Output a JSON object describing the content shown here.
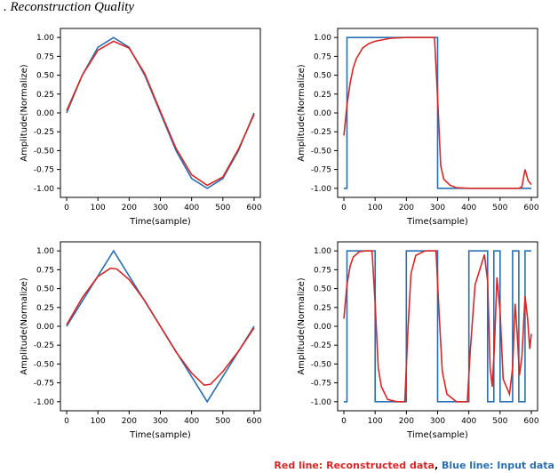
{
  "heading": ". Reconstruction Quality",
  "legend": {
    "red": "Red line: Reconstructed data",
    "blue": "Blue line: Input data"
  },
  "axes": {
    "xlabel": "Time(sample)",
    "ylabel": "Amplitude(Normalize)",
    "xticks": [
      0,
      100,
      200,
      300,
      400,
      500,
      600
    ],
    "yticks": [
      -1.0,
      -0.75,
      -0.5,
      -0.25,
      0.0,
      0.25,
      0.5,
      0.75,
      1.0
    ],
    "xlim": [
      -20,
      620
    ],
    "ylim": [
      -1.12,
      1.12
    ]
  },
  "chart_data": [
    {
      "id": "tl",
      "type": "line",
      "title": "",
      "xlabel": "Time(sample)",
      "ylabel": "Amplitude(Normalize)",
      "xlim": [
        -20,
        620
      ],
      "ylim": [
        -1.12,
        1.12
      ],
      "series": [
        {
          "name": "Input",
          "color": "#2a6fb1",
          "x": [
            0,
            50,
            100,
            150,
            200,
            250,
            300,
            350,
            400,
            450,
            500,
            550,
            600
          ],
          "y": [
            0.0,
            0.5,
            0.87,
            1.0,
            0.87,
            0.5,
            0.0,
            -0.5,
            -0.87,
            -1.0,
            -0.87,
            -0.5,
            0.0
          ]
        },
        {
          "name": "Reconstructed",
          "color": "#d62728",
          "x": [
            0,
            50,
            100,
            150,
            200,
            250,
            300,
            350,
            400,
            450,
            500,
            550,
            600
          ],
          "y": [
            0.03,
            0.5,
            0.83,
            0.95,
            0.86,
            0.52,
            0.02,
            -0.47,
            -0.82,
            -0.96,
            -0.85,
            -0.48,
            -0.02
          ]
        }
      ]
    },
    {
      "id": "tr",
      "type": "line",
      "title": "",
      "xlabel": "Time(sample)",
      "ylabel": "Amplitude(Normalize)",
      "xlim": [
        -20,
        620
      ],
      "ylim": [
        -1.12,
        1.12
      ],
      "series": [
        {
          "name": "Input",
          "color": "#2a6fb1",
          "x": [
            0,
            10,
            10,
            300,
            300,
            600
          ],
          "y": [
            -1.0,
            -1.0,
            1.0,
            1.0,
            -1.0,
            -1.0
          ]
        },
        {
          "name": "Reconstructed",
          "color": "#d62728",
          "x": [
            0,
            10,
            20,
            30,
            40,
            60,
            80,
            100,
            150,
            200,
            250,
            290,
            300,
            310,
            320,
            340,
            360,
            400,
            500,
            560,
            570,
            580,
            590,
            600
          ],
          "y": [
            -0.3,
            0.1,
            0.4,
            0.6,
            0.72,
            0.86,
            0.92,
            0.95,
            0.99,
            1.0,
            1.0,
            1.0,
            0.2,
            -0.7,
            -0.88,
            -0.96,
            -0.99,
            -1.0,
            -1.0,
            -1.0,
            -0.98,
            -0.75,
            -0.9,
            -0.95
          ]
        }
      ]
    },
    {
      "id": "bl",
      "type": "line",
      "title": "",
      "xlabel": "Time(sample)",
      "ylabel": "Amplitude(Normalize)",
      "xlim": [
        -20,
        620
      ],
      "ylim": [
        -1.12,
        1.12
      ],
      "series": [
        {
          "name": "Input",
          "color": "#2a6fb1",
          "x": [
            0,
            150,
            450,
            600
          ],
          "y": [
            0.0,
            1.0,
            -1.0,
            0.0
          ]
        },
        {
          "name": "Reconstructed",
          "color": "#d62728",
          "x": [
            0,
            50,
            100,
            140,
            160,
            200,
            250,
            300,
            350,
            400,
            440,
            460,
            500,
            550,
            600
          ],
          "y": [
            0.02,
            0.38,
            0.66,
            0.77,
            0.76,
            0.62,
            0.34,
            0.0,
            -0.34,
            -0.62,
            -0.78,
            -0.77,
            -0.6,
            -0.33,
            -0.02
          ]
        }
      ]
    },
    {
      "id": "br",
      "type": "line",
      "title": "",
      "xlabel": "Time(sample)",
      "ylabel": "Amplitude(Normalize)",
      "xlim": [
        -20,
        620
      ],
      "ylim": [
        -1.12,
        1.12
      ],
      "series": [
        {
          "name": "Input",
          "color": "#2a6fb1",
          "x": [
            0,
            10,
            10,
            100,
            100,
            200,
            200,
            300,
            300,
            400,
            400,
            460,
            460,
            480,
            480,
            500,
            500,
            540,
            540,
            560,
            560,
            580,
            580,
            600
          ],
          "y": [
            -1.0,
            -1.0,
            1.0,
            1.0,
            -1.0,
            -1.0,
            1.0,
            1.0,
            -1.0,
            -1.0,
            1.0,
            1.0,
            -1.0,
            -1.0,
            1.0,
            1.0,
            -1.0,
            -1.0,
            1.0,
            1.0,
            -1.0,
            -1.0,
            1.0,
            1.0
          ]
        },
        {
          "name": "Reconstructed",
          "color": "#d62728",
          "x": [
            0,
            10,
            20,
            30,
            50,
            70,
            90,
            100,
            110,
            120,
            140,
            170,
            195,
            205,
            215,
            230,
            260,
            295,
            305,
            315,
            330,
            360,
            395,
            405,
            420,
            450,
            460,
            468,
            475,
            482,
            490,
            500,
            510,
            530,
            540,
            548,
            555,
            562,
            570,
            580,
            588,
            595,
            600
          ],
          "y": [
            0.1,
            0.55,
            0.8,
            0.92,
            0.99,
            1.0,
            1.0,
            0.3,
            -0.55,
            -0.8,
            -0.97,
            -1.0,
            -1.0,
            -0.05,
            0.7,
            0.94,
            1.0,
            1.0,
            0.15,
            -0.6,
            -0.9,
            -1.0,
            -1.0,
            -0.3,
            0.55,
            0.95,
            0.6,
            -0.55,
            -0.8,
            -0.25,
            0.65,
            0.2,
            -0.7,
            -0.9,
            -0.55,
            0.3,
            -0.1,
            -0.65,
            -0.4,
            0.4,
            0.1,
            -0.3,
            -0.1
          ]
        }
      ]
    }
  ]
}
